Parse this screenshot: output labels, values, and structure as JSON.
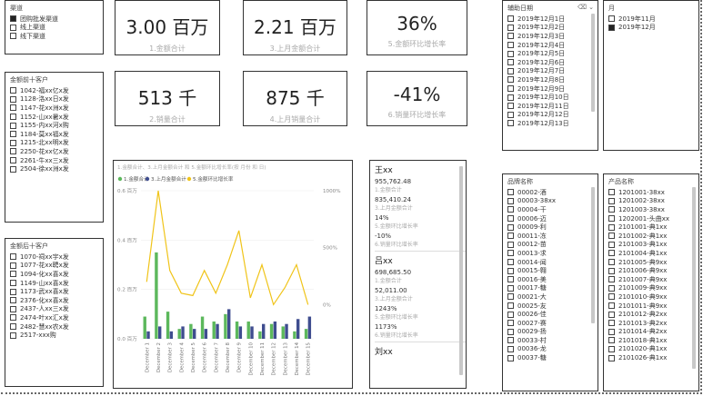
{
  "channel": {
    "title": "渠道",
    "items": [
      {
        "label": "团购批发渠道",
        "checked": true
      },
      {
        "label": "线上渠道",
        "checked": false
      },
      {
        "label": "线下渠道",
        "checked": false
      }
    ]
  },
  "top10": {
    "title": "金额前十客户",
    "items": [
      "1042-福xx亿x发",
      "1128-洛xx日x发",
      "1147-花xx洲x发",
      "1152-山xx暑x发",
      "1155-内xx河x购",
      "1184-莫xx福x发",
      "1215-北xx明x发",
      "2250-花xx亿x发",
      "2261-牛xx三x发",
      "2504-徐xx洲x发"
    ]
  },
  "bottom10": {
    "title": "金额后十客户",
    "items": [
      "1070-祠xx宇x发",
      "1077-花xx聘x发",
      "1094-化xx喜x发",
      "1149-山xx喜x发",
      "1173-武xx喜x发",
      "2376-化xx喜x发",
      "2437-人xx三x发",
      "2474-叶xx汇x发",
      "2482-慧xx农x发",
      "2517-xxx购"
    ]
  },
  "kpis": [
    {
      "value": "3.00 百万",
      "label": "1.金额合计"
    },
    {
      "value": "2.21 百万",
      "label": "3.上月金额合计"
    },
    {
      "value": "36%",
      "label": "5.金额环比增长率"
    },
    {
      "value": "513 千",
      "label": "2.销量合计"
    },
    {
      "value": "875 千",
      "label": "4.上月销量合计"
    },
    {
      "value": "-41%",
      "label": "6.销量环比增长率"
    }
  ],
  "chart_data": {
    "type": "bar",
    "title": "1.金额合计、3.上月金额合计 和 5.金额环比增长率(按 月份 和 日)",
    "categories": [
      "December 1",
      "December 2",
      "December 3",
      "December 4",
      "December 5",
      "December 6",
      "December 7",
      "December 8",
      "December 9",
      "December 10",
      "December 11",
      "December 12",
      "December 13",
      "December 14",
      "December 15"
    ],
    "series": [
      {
        "name": "1.金额合计",
        "color": "#5cb85c",
        "axis": "left",
        "values": [
          0.09,
          0.35,
          0.11,
          0.04,
          0.06,
          0.09,
          0.07,
          0.1,
          0.07,
          0.07,
          0.03,
          0.06,
          0.05,
          0.03,
          0.04
        ]
      },
      {
        "name": "3.上月金额合计",
        "color": "#3f4d8f",
        "axis": "left",
        "values": [
          0.03,
          0.05,
          0.03,
          0.05,
          0.04,
          0.04,
          0.06,
          0.12,
          0.05,
          0.05,
          0.06,
          0.07,
          0.06,
          0.08,
          0.09
        ]
      },
      {
        "name": "5.金额环比增长率",
        "color": "#f0c419",
        "axis": "right",
        "values": [
          200,
          1000,
          300,
          100,
          80,
          300,
          100,
          350,
          650,
          60,
          350,
          0,
          150,
          350,
          0
        ]
      }
    ],
    "yticks": [
      "0.0 百万",
      "0.2 百万",
      "0.4 百万",
      "0.6 百万"
    ],
    "y2ticks": [
      "0%",
      "500%",
      "1000%"
    ],
    "ylim": [
      0,
      0.6
    ],
    "y2lim": [
      -300,
      1000
    ]
  },
  "matrix": {
    "groups": [
      {
        "name": "王xx",
        "rows": [
          {
            "value": "955,762.48",
            "label": "1.金额合计"
          },
          {
            "value": "835,410.24",
            "label": "3.上月金额合计"
          },
          {
            "value": "14%",
            "label": "5.金额环比增长率"
          },
          {
            "value": "-10%",
            "label": "6.销量环比增长率"
          }
        ]
      },
      {
        "name": "吕xx",
        "rows": [
          {
            "value": "698,685.50",
            "label": "1.金额合计"
          },
          {
            "value": "52,011.00",
            "label": "3.上月金额合计"
          },
          {
            "value": "1243%",
            "label": "5.金额环比增长率"
          },
          {
            "value": "1173%",
            "label": "6.销量环比增长率"
          }
        ]
      },
      {
        "name": "刘xx",
        "rows": []
      }
    ]
  },
  "dates": {
    "title": "辅助日期",
    "items": [
      "2019年12月1日",
      "2019年12月2日",
      "2019年12月3日",
      "2019年12月4日",
      "2019年12月5日",
      "2019年12月6日",
      "2019年12月7日",
      "2019年12月8日",
      "2019年12月9日",
      "2019年12月10日",
      "2019年12月11日",
      "2019年12月12日",
      "2019年12月13日"
    ]
  },
  "month": {
    "title": "月",
    "items": [
      {
        "label": "2019年11月",
        "checked": false
      },
      {
        "label": "2019年12月",
        "checked": true
      }
    ]
  },
  "brand": {
    "title": "品牌名称",
    "items": [
      "00002-酒",
      "00003-38xx",
      "00004-干",
      "00006-迈",
      "00009-利",
      "00011-冻",
      "00012-苗",
      "00013-求",
      "00014-闻",
      "00015-翱",
      "00016-美",
      "00017-糖",
      "00021-大",
      "00025-友",
      "00026-佳",
      "00027-赛",
      "00029-扬",
      "00033-村",
      "00036-龙",
      "00037-糖"
    ]
  },
  "product": {
    "title": "产品名称",
    "items": [
      "1201001-38xx",
      "1201002-38xx",
      "1201003-38xx",
      "1202001-头曲xx",
      "2101001-典1xx",
      "2101002-典1xx",
      "2101003-典1xx",
      "2101004-典1xx",
      "2101005-典9xx",
      "2101006-典9xx",
      "2101007-典9xx",
      "2101009-典9xx",
      "2101010-典9xx",
      "2101011-典9xx",
      "2101012-典2xx",
      "2101013-典2xx",
      "2101014-典2xx",
      "2101018-典1xx",
      "2101020-典1xx",
      "2101026-典1xx"
    ]
  }
}
